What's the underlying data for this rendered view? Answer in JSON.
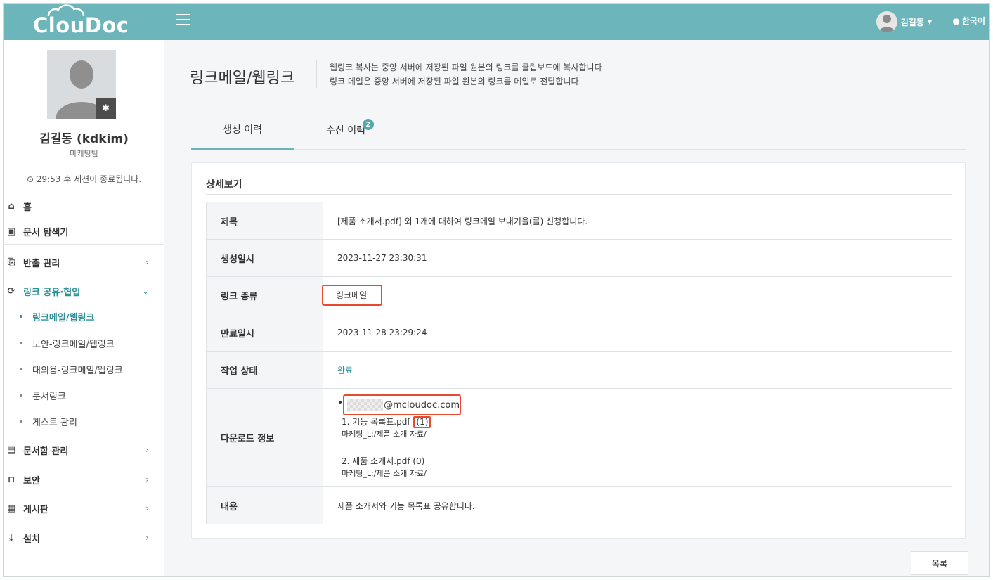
{
  "app": {
    "logo": "ClouDoc"
  },
  "header": {
    "user_name": "김길동",
    "language": "한국어"
  },
  "profile": {
    "name": "김길동 (kdkim)",
    "team": "마케팅팀",
    "session": "29:53 후 세션이 종료됩니다."
  },
  "nav": {
    "home": "홈",
    "explorer": "문서 탐색기",
    "export": "반출 관리",
    "share": "링크 공유·협업",
    "share_sub": [
      "링크메일/웹링크",
      "보안-링크메일/웹링크",
      "대외용-링크메일/웹링크",
      "문서링크",
      "게스트 관리"
    ],
    "docbox": "문서함 관리",
    "security": "보안",
    "board": "게시판",
    "install": "설치"
  },
  "page": {
    "title": "링크메일/웹링크",
    "desc1": "웹링크 복사는 중앙 서버에 저장된 파일 원본의 링크를 클립보드에 복사합니다",
    "desc2": "링크 메일은 중앙 서버에 저장된 파일 원본의 링크를 메일로 전달합니다."
  },
  "tabs": {
    "created": "생성 이력",
    "received": "수신 이력",
    "received_badge": "2"
  },
  "detail": {
    "section_title": "상세보기",
    "labels": {
      "title": "제목",
      "created_at": "생성일시",
      "link_type": "링크 종류",
      "expires_at": "만료일시",
      "status": "작업 상태",
      "download": "다운로드 정보",
      "content": "내용"
    },
    "values": {
      "title": "[제품 소개서.pdf] 외 1개에 대하여 링크메일 보내기을(를) 신청합니다.",
      "created_at": "2023-11-27 23:30:31",
      "link_type": "링크메일",
      "expires_at": "2023-11-28 23:29:24",
      "status": "완료",
      "content": "제품 소개서와 기능 목록표 공유합니다."
    },
    "download": {
      "email_domain": "@mcloudoc.com",
      "file1_name": "1. 기능 목록표.pdf",
      "file1_count": "(1)",
      "file1_path": "마케팅_L:/제품 소개 자료/",
      "file2_name": "2. 제품 소개서.pdf (0)",
      "file2_path": "마케팅_L:/제품 소개 자료/"
    }
  },
  "buttons": {
    "list": "목록"
  },
  "colors": {
    "accent": "#6cb5bb",
    "highlight": "#e8492f",
    "active_text": "#2e8f96"
  }
}
